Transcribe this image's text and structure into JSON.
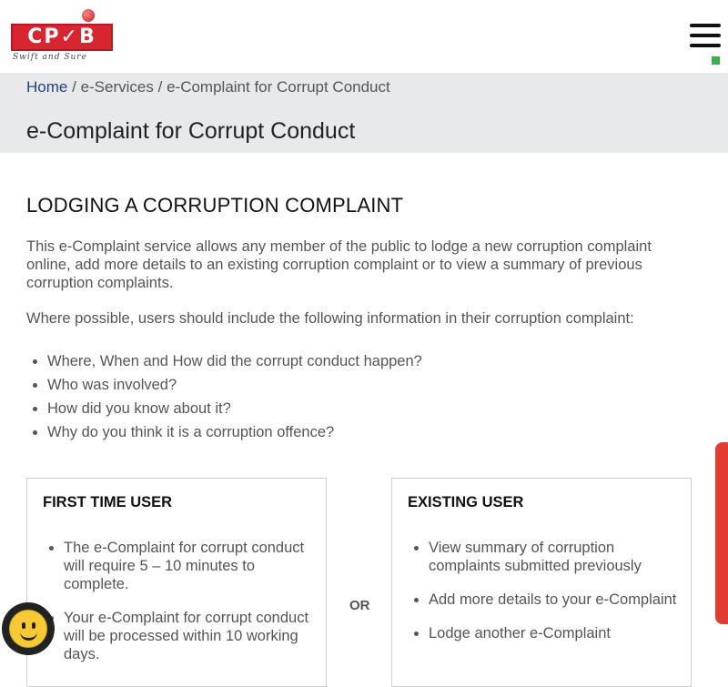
{
  "header": {
    "logo_text": "CP✓B",
    "logo_tagline": "Swift and Sure",
    "menu_icon": "hamburger-menu-icon"
  },
  "breadcrumb": {
    "home": "Home",
    "separator": "/",
    "services": "e-Services",
    "current": "e-Complaint for Corrupt Conduct"
  },
  "page_title": "e-Complaint for Corrupt Conduct",
  "main": {
    "section_heading": "LODGING A CORRUPTION COMPLAINT",
    "intro": "This e-Complaint service allows any member of the public to lodge a new corruption complaint online, add more details to an existing corruption complaint or to view a summary of previous corruption complaints.",
    "intro2": "Where possible, users should include the following information in their corruption complaint:",
    "info_items": [
      "Where, When and How did the corrupt conduct happen?",
      "Who was involved?",
      "How did you know about it?",
      "Why do you think it is a corruption offence?"
    ]
  },
  "cards": {
    "first_time": {
      "title": "FIRST TIME USER",
      "items": [
        "The e-Complaint for corrupt conduct will require 5 – 10 minutes to complete.",
        "Your e-Complaint for corrupt conduct will be processed within 10 working days."
      ]
    },
    "or_label": "OR",
    "existing": {
      "title": "EXISTING USER",
      "items": [
        "View summary of corruption complaints submitted previously",
        "Add more details to your e-Complaint",
        "Lodge another e-Complaint"
      ]
    }
  },
  "colors": {
    "brand_red": "#d7262f",
    "link_blue": "#1f3f92",
    "band_gray": "#e8e9ea",
    "feedback_red": "#e03c31"
  }
}
